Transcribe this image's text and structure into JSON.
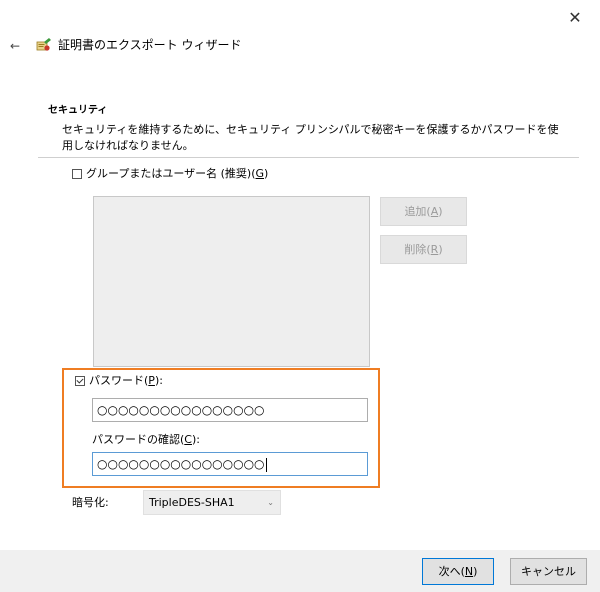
{
  "window": {
    "title": "証明書のエクスポート ウィザード",
    "close_glyph": "✕",
    "back_glyph": "←"
  },
  "section": {
    "heading": "セキュリティ",
    "description": "セキュリティを維持するために、セキュリティ プリンシパルで秘密キーを保護するかパスワードを使用しなければなりません。"
  },
  "group_option": {
    "checked": false,
    "label_prefix": "グループまたはユーザー名 (推奨)(",
    "label_key": "G",
    "label_suffix": ")"
  },
  "buttons": {
    "add_prefix": "追加(",
    "add_key": "A",
    "add_suffix": ")",
    "remove_prefix": "削除(",
    "remove_key": "R",
    "remove_suffix": ")"
  },
  "password_option": {
    "checked": true,
    "label_prefix": "パスワード(",
    "label_key": "P",
    "label_suffix": "):"
  },
  "password_field": {
    "value": "○○○○○○○○○○○○○○○○"
  },
  "confirm": {
    "label_prefix": "パスワードの確認(",
    "label_key": "C",
    "label_suffix": "):",
    "value": "○○○○○○○○○○○○○○○○"
  },
  "encryption": {
    "label": "暗号化:",
    "selected": "TripleDES-SHA1",
    "arrow_glyph": "⌄"
  },
  "footer": {
    "next_prefix": "次へ(",
    "next_key": "N",
    "next_suffix": ")",
    "cancel_label": "キャンセル"
  },
  "colors": {
    "highlight": "#ef7d23",
    "focus_border": "#5b9bd5",
    "default_button_border": "#0078d7"
  }
}
